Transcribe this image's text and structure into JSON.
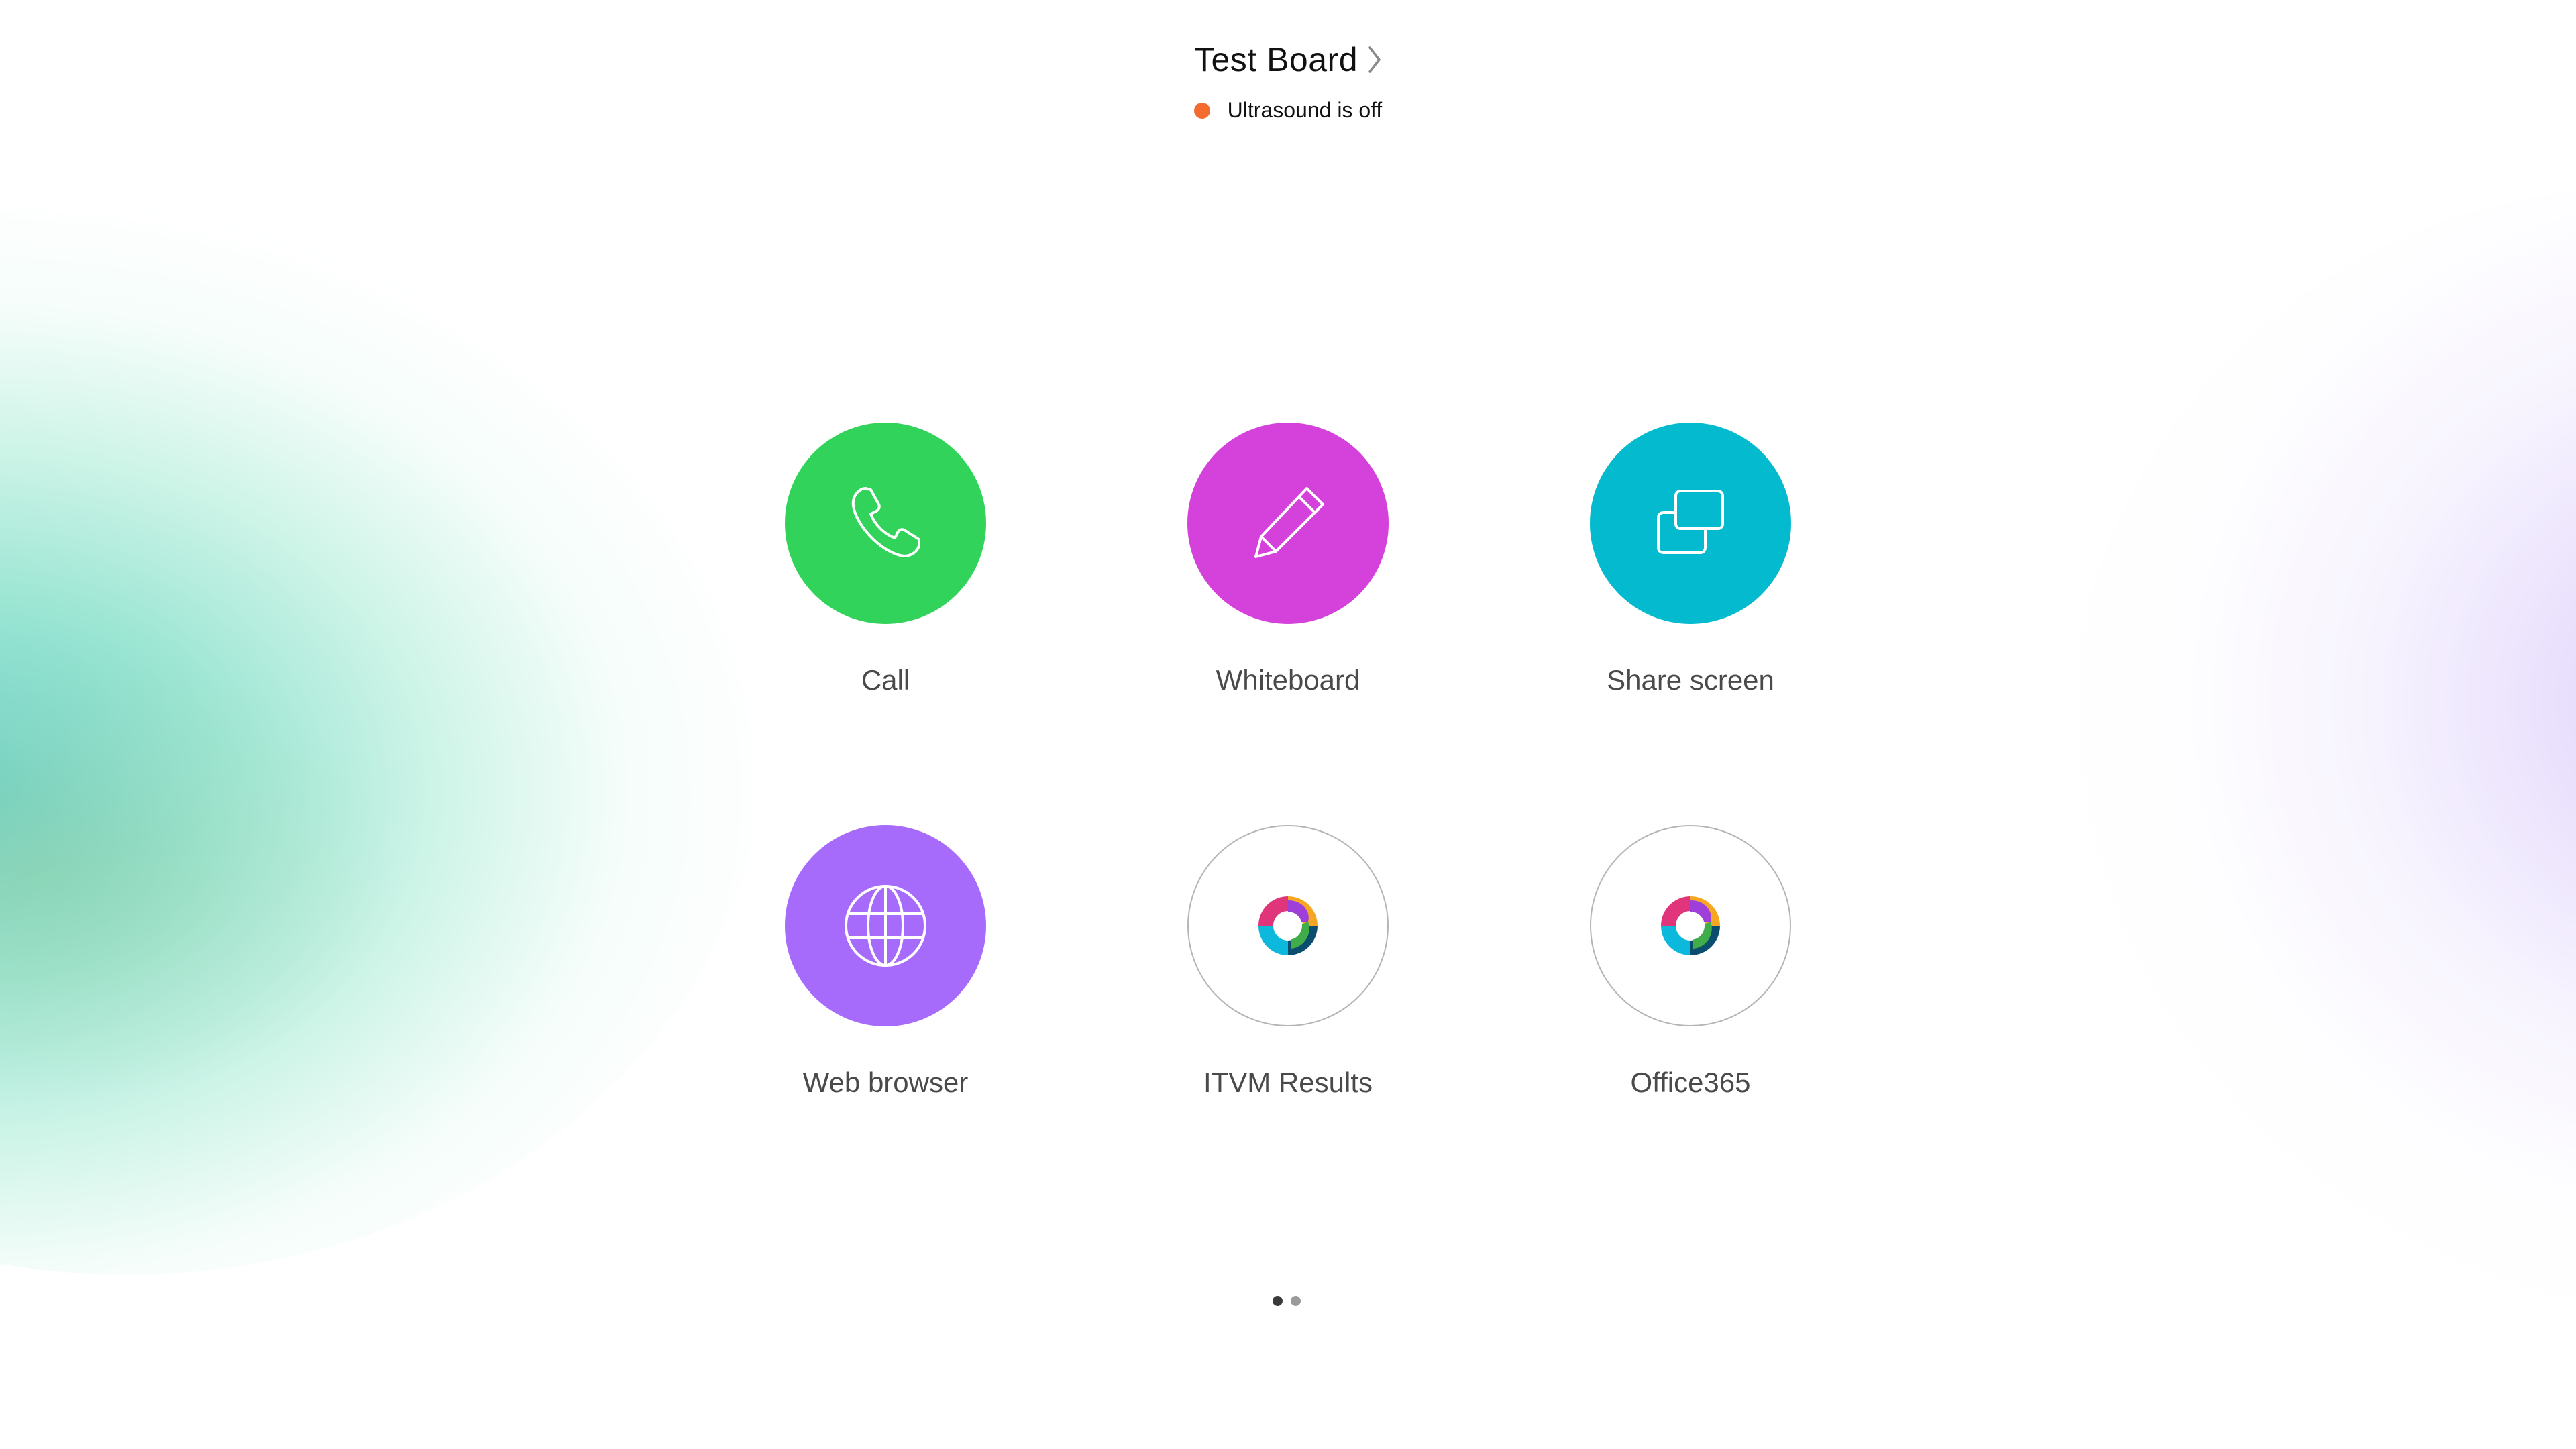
{
  "header": {
    "title": "Test Board",
    "status_text": "Ultrasound is off",
    "status_color": "#f46b2e"
  },
  "tiles": [
    {
      "label": "Call",
      "icon": "phone-icon",
      "color": "#32d35a"
    },
    {
      "label": "Whiteboard",
      "icon": "pencil-icon",
      "color": "#d542db"
    },
    {
      "label": "Share screen",
      "icon": "share-screen-icon",
      "color": "#03bacf"
    },
    {
      "label": "Web browser",
      "icon": "globe-icon",
      "color": "#a66bfa"
    },
    {
      "label": "ITVM Results",
      "icon": "webex-logo-icon",
      "color": "#ffffff"
    },
    {
      "label": "Office365",
      "icon": "webex-logo-icon",
      "color": "#ffffff"
    }
  ],
  "pager": {
    "pages": 2,
    "active_page": 1,
    "active_color": "#3a3a3a",
    "inactive_color": "#9a9a9a"
  }
}
